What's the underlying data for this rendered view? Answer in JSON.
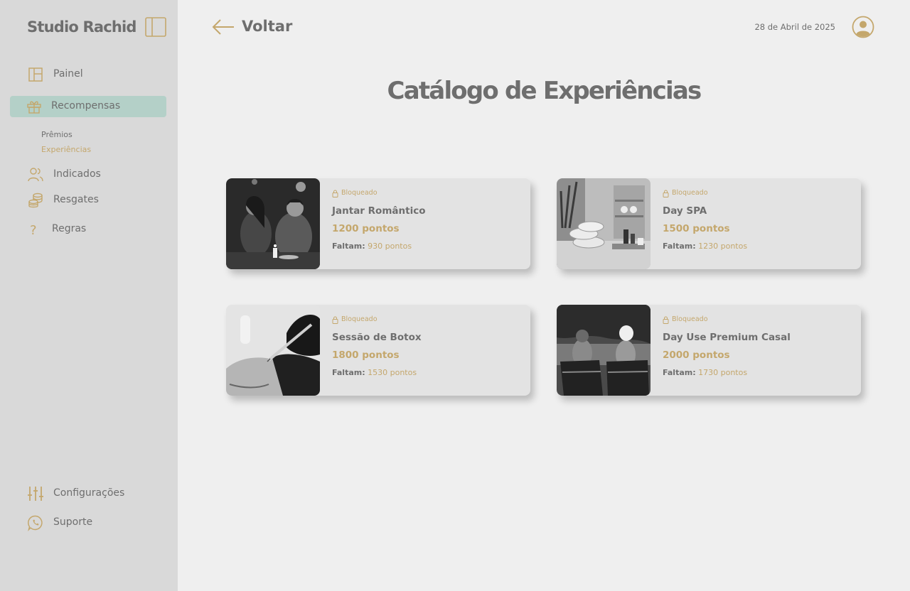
{
  "app": {
    "brand": "Studio Rachid"
  },
  "colors": {
    "accent": "#c4a76c",
    "active_bg": "#b4d0c8",
    "sidebar_bg": "#d9d9d9",
    "text": "#6e6e6e"
  },
  "sidebar": {
    "items": [
      {
        "label": "Painel",
        "icon": "layout-icon"
      },
      {
        "label": "Recompensas",
        "icon": "gift-icon",
        "active": true
      },
      {
        "label": "Indicados",
        "icon": "users-icon"
      },
      {
        "label": "Resgates",
        "icon": "coins-icon"
      },
      {
        "label": "Regras",
        "icon": "question-icon"
      }
    ],
    "subitems": [
      {
        "label": "Prêmios"
      },
      {
        "label": "Experiências",
        "active": true
      }
    ],
    "bottom": [
      {
        "label": "Configurações",
        "icon": "sliders-icon"
      },
      {
        "label": "Suporte",
        "icon": "whatsapp-icon"
      }
    ]
  },
  "header": {
    "back_label": "Voltar",
    "date": "28 de Abril de 2025"
  },
  "page": {
    "title": "Catálogo de Experiências"
  },
  "cards": [
    {
      "status": "Bloqueado",
      "title": "Jantar Romântico",
      "points": "1200 pontos",
      "missing_label": "Faltam:",
      "missing_value": "930 pontos"
    },
    {
      "status": "Bloqueado",
      "title": "Day SPA",
      "points": "1500 pontos",
      "missing_label": "Faltam:",
      "missing_value": "1230 pontos"
    },
    {
      "status": "Bloqueado",
      "title": "Sessão de Botox",
      "points": "1800 pontos",
      "missing_label": "Faltam:",
      "missing_value": "1530 pontos"
    },
    {
      "status": "Bloqueado",
      "title": "Day Use Premium Casal",
      "points": "2000 pontos",
      "missing_label": "Faltam:",
      "missing_value": "1730 pontos"
    }
  ]
}
